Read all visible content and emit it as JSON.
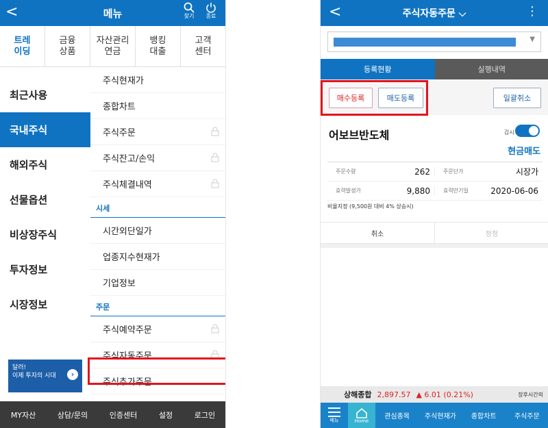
{
  "left": {
    "header": {
      "title": "메뉴",
      "search_label": "찾기",
      "power_label": "종료"
    },
    "categories": [
      "트레\n이딩",
      "금융\n상품",
      "자산관리\n연금",
      "뱅킹\n대출",
      "고객\n센터"
    ],
    "sidebar": [
      "최근사용",
      "국내주식",
      "해외주식",
      "선물옵션",
      "비상장주식",
      "투자정보",
      "시장정보"
    ],
    "submenu": {
      "items_top": [
        "주식현재가",
        "종합차트",
        "주식주문",
        "주식잔고/손익",
        "주식체결내역"
      ],
      "section1": "시세",
      "items_mid": [
        "시간외단일가",
        "업종지수현재가",
        "기업정보"
      ],
      "section2": "주문",
      "items_bot": [
        "주식예약주문",
        "주식자동주문",
        "주식추가주문"
      ]
    },
    "banner": {
      "line1": "달러!",
      "line2": "이제 투자의 시대"
    },
    "footer": [
      "MY자산",
      "상담/문의",
      "인증센터",
      "설정",
      "로그인"
    ]
  },
  "right": {
    "header": {
      "title": "주식자동주문"
    },
    "tabs": [
      "등록현황",
      "실행내역"
    ],
    "buttons": {
      "buy": "매수등록",
      "sell": "매도등록",
      "cancel_all": "일괄취소"
    },
    "order": {
      "stock": "어보브반도체",
      "watch_label": "감시",
      "type": "현금매도",
      "qty_label": "주문수량",
      "qty": "262",
      "price_label": "주문단가",
      "price": "시장가",
      "trigger_label": "효력발생가",
      "trigger": "9,880",
      "expire_label": "효력만기일",
      "expire": "2020-06-06",
      "note": "비율지정 (9,500원 대비 4% 상승시)",
      "cancel": "취소",
      "modify": "정정"
    },
    "ticker": {
      "name": "상해종합",
      "value": "2,897.57",
      "change": "▲ 6.01 (0.21%)",
      "after": "장후시간외"
    },
    "nav": {
      "menu": "메뉴",
      "home": "Home",
      "items": [
        "관심종목",
        "주식현재가",
        "종합차트",
        "주식주문"
      ]
    },
    "accent_color": "#0f73c2"
  }
}
